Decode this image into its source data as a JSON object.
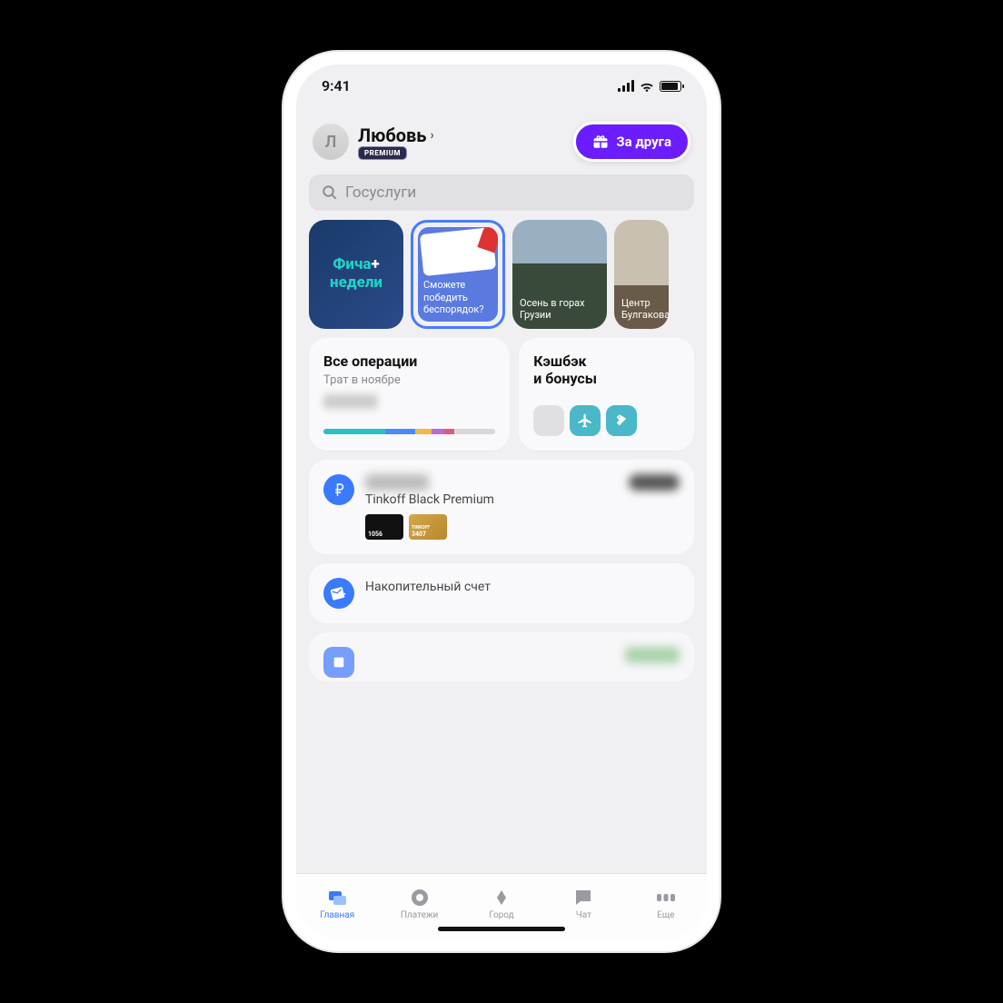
{
  "status": {
    "time": "9:41"
  },
  "header": {
    "avatar_initial": "Л",
    "name": "Любовь",
    "premium_label": "PREMIUM",
    "promo_label": "За друга"
  },
  "search": {
    "placeholder": "Госуслуги"
  },
  "stories": [
    {
      "type": "feature",
      "title_line1": "Фича",
      "title_line2": "недели"
    },
    {
      "type": "quiz",
      "caption": "Сможете победить беспорядок?"
    },
    {
      "type": "photo",
      "caption": "Осень в горах Грузии"
    },
    {
      "type": "photo",
      "caption": "Центр Булгакова"
    }
  ],
  "tiles": {
    "ops": {
      "title": "Все операции",
      "subtitle": "Трат в ноябре"
    },
    "bonus": {
      "title_line1": "Кэшбэк",
      "title_line2": "и бонусы"
    }
  },
  "accounts": [
    {
      "icon": "ruble",
      "name": "Tinkoff Black Premium",
      "cards": [
        {
          "style": "black",
          "digits": "1056"
        },
        {
          "style": "gold",
          "label": "TINKOFF",
          "digits": "3407"
        }
      ]
    },
    {
      "icon": "wallet",
      "name": "Накопительный счет"
    }
  ],
  "tabs": [
    {
      "key": "home",
      "label": "Главная",
      "active": true
    },
    {
      "key": "payments",
      "label": "Платежи",
      "active": false
    },
    {
      "key": "city",
      "label": "Город",
      "active": false
    },
    {
      "key": "chat",
      "label": "Чат",
      "active": false
    },
    {
      "key": "more",
      "label": "Еще",
      "active": false
    }
  ]
}
